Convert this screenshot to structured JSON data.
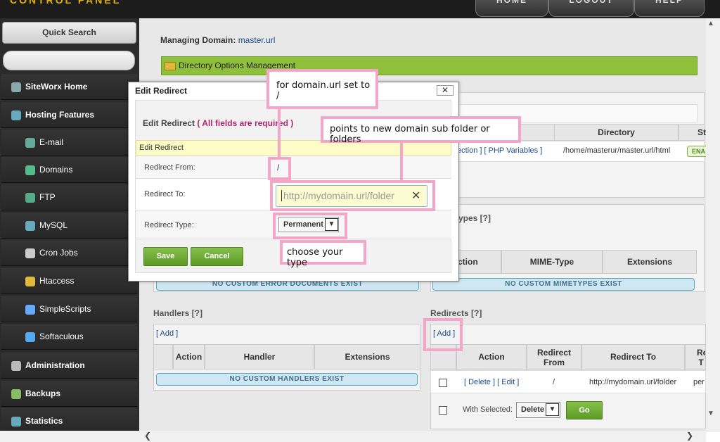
{
  "header": {
    "brand": "CONTROL PANEL",
    "nav": [
      "HOME",
      "LOGOUT",
      "HELP"
    ]
  },
  "sidebar": {
    "quick_search": "Quick Search",
    "items": [
      {
        "label": "SiteWorx Home",
        "icon": "home-icon",
        "main": true
      },
      {
        "label": "Hosting Features",
        "icon": "monitor-icon",
        "main": true
      },
      {
        "label": "E-mail",
        "icon": "email-icon",
        "main": false
      },
      {
        "label": "Domains",
        "icon": "globe-icon",
        "main": false
      },
      {
        "label": "FTP",
        "icon": "ftp-icon",
        "main": false
      },
      {
        "label": "MySQL",
        "icon": "database-icon",
        "main": false
      },
      {
        "label": "Cron Jobs",
        "icon": "clock-icon",
        "main": false
      },
      {
        "label": "Htaccess",
        "icon": "folder-icon",
        "main": false
      },
      {
        "label": "SimpleScripts",
        "icon": "script-icon",
        "main": false
      },
      {
        "label": "Softaculous",
        "icon": "softaculous-icon",
        "main": false
      },
      {
        "label": "Administration",
        "icon": "wrench-icon",
        "main": true
      },
      {
        "label": "Backups",
        "icon": "backup-icon",
        "main": true
      },
      {
        "label": "Statistics",
        "icon": "chart-icon",
        "main": true
      }
    ]
  },
  "main": {
    "managing_label": "Managing Domain:",
    "managing_domain": "master.url",
    "dir_bar": "Directory Options Management",
    "dir_table": {
      "col_directory": "Directory",
      "col_status_partial": "St",
      "links": "ection ] [ PHP Variables ]",
      "link_php": "PHP Variables",
      "path": "/home/masterur/master.url/html",
      "status_partial": "ENA"
    },
    "mimetypes": {
      "title_partial": "ypes [?]",
      "col_action_partial": "ction",
      "col_mime": "MIME-Type",
      "col_ext": "Extensions",
      "empty": "NO CUSTOM MIMETYPES EXIST"
    },
    "error_docs": {
      "empty": "NO CUSTOM ERROR DOCUMENTS EXIST"
    },
    "handlers": {
      "title": "Handlers [?]",
      "add": "[ Add ]",
      "col_action": "Action",
      "col_handler": "Handler",
      "col_ext": "Extensions",
      "empty": "NO CUSTOM HANDLERS EXIST"
    },
    "redirects": {
      "title": "Redirects [?]",
      "add": "[ Add ]",
      "col_action": "Action",
      "col_from": "Redirect From",
      "col_to": "Redirect To",
      "col_partial": "Re T",
      "row": {
        "actions": "[ Delete ] [ Edit ]",
        "from": "/",
        "to": "http://mydomain.url/folder",
        "extra": "per"
      },
      "with_selected": "With Selected:",
      "bulk_option": "Delete",
      "go": "Go"
    }
  },
  "dialog": {
    "title": "Edit Redirect",
    "close": "✕",
    "heading": "Edit Redirect",
    "required": "( All fields are required )",
    "section": "Edit Redirect",
    "from_label": "Redirect From:",
    "from_value": "/",
    "to_label": "Redirect To:",
    "to_placeholder": "http://mydomain.url/folder",
    "type_label": "Redirect Type:",
    "type_value": "Permanent",
    "save": "Save",
    "cancel": "Cancel"
  },
  "annotations": {
    "from_note": "for domain.url set to /",
    "to_note": "points to new domain sub folder or folders",
    "type_note": "choose your type"
  }
}
